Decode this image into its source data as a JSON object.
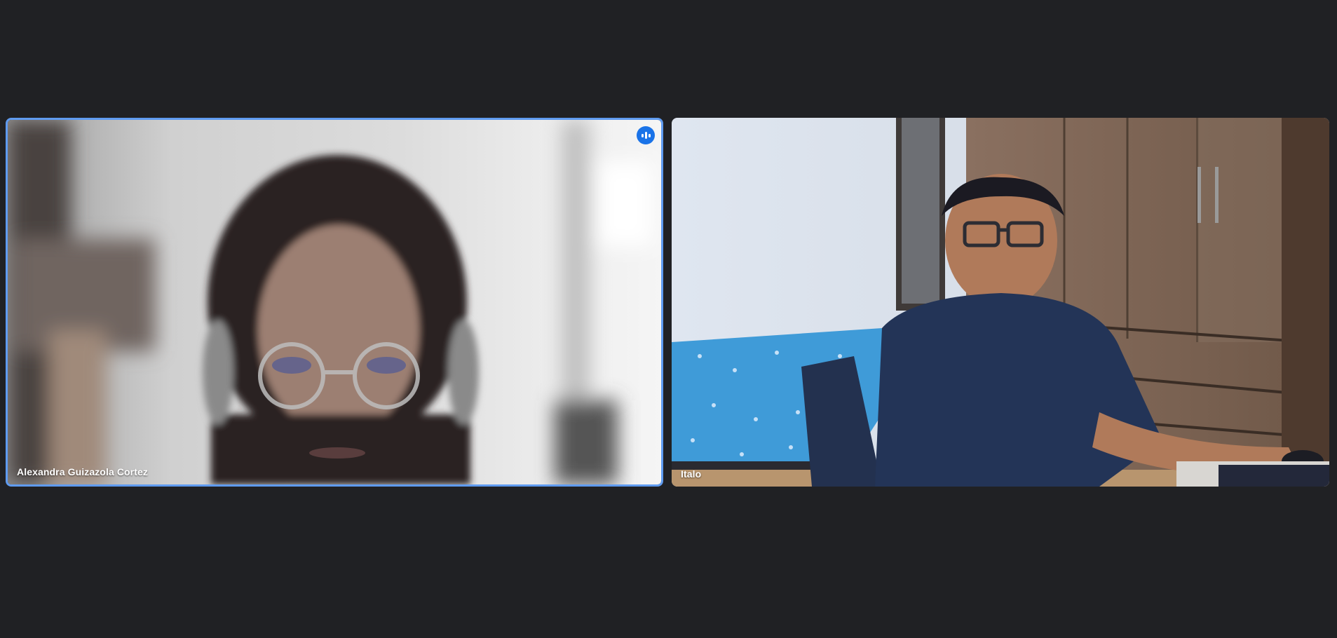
{
  "participants": [
    {
      "name": "Alexandra Guizazola Cortez",
      "speaking": true,
      "indicator_icon": "audio-level-icon"
    },
    {
      "name": "Italo",
      "speaking": false
    }
  ],
  "colors": {
    "background": "#202124",
    "active_speaker_border": "#5f9bf0",
    "indicator_bg": "#1a73e8"
  }
}
